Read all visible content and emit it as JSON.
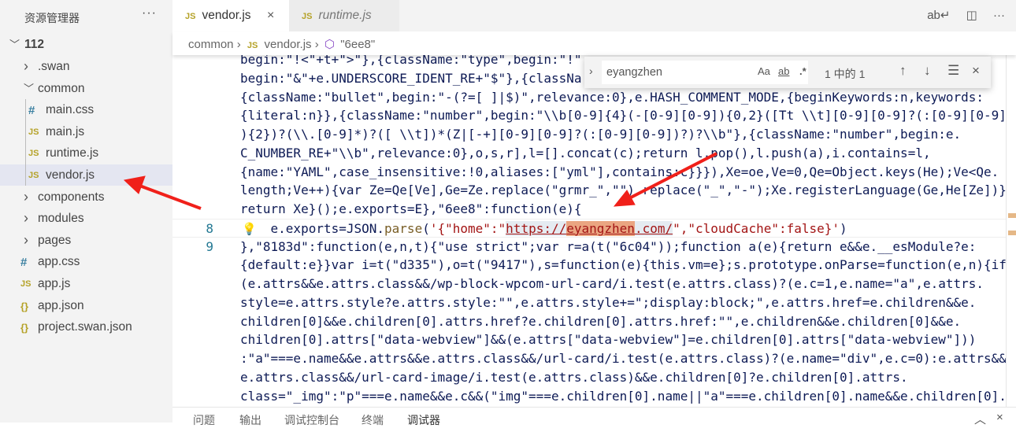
{
  "sidebar": {
    "title": "资源管理器",
    "more": "···",
    "root": "112",
    "items": [
      {
        "label": ".swan",
        "type": "folder",
        "open": false
      },
      {
        "label": "common",
        "type": "folder",
        "open": true
      },
      {
        "label": "main.css",
        "type": "css"
      },
      {
        "label": "main.js",
        "type": "js"
      },
      {
        "label": "runtime.js",
        "type": "js"
      },
      {
        "label": "vendor.js",
        "type": "js",
        "selected": true
      },
      {
        "label": "components",
        "type": "folder",
        "open": false
      },
      {
        "label": "modules",
        "type": "folder",
        "open": false
      },
      {
        "label": "pages",
        "type": "folder",
        "open": false
      },
      {
        "label": "app.css",
        "type": "css"
      },
      {
        "label": "app.js",
        "type": "js"
      },
      {
        "label": "app.json",
        "type": "json"
      },
      {
        "label": "project.swan.json",
        "type": "json"
      }
    ]
  },
  "icons": {
    "js": "JS",
    "css": "#",
    "json": "{}",
    "close": "×",
    "wrap": "word-wrap-icon",
    "split": "split-editor-icon",
    "more": "···"
  },
  "tabs": [
    {
      "label": "vendor.js",
      "active": true
    },
    {
      "label": "runtime.js",
      "active": false
    }
  ],
  "breadcrumb": [
    "common",
    "vendor.js",
    "\"6ee8\""
  ],
  "find": {
    "value": "eyangzhen",
    "match_case": "Aa",
    "whole_word": "ab",
    "regex": ".*",
    "count": "1 中的 1"
  },
  "editor": {
    "rows": [
      {
        "text": "begin:\"!<\"+t+\">\"},{className:\"type\",begin:\"!\""
      },
      {
        "text": "begin:\"&\"+e.UNDERSCORE_IDENT_RE+\"$\"},{classNa"
      },
      {
        "text": "{className:\"bullet\",begin:\"-(?=[ ]|$)\",relevance:0},e.HASH_COMMENT_MODE,{beginKeywords:n,keywords:"
      },
      {
        "text": "{literal:n}},{className:\"number\",begin:\"\\\\b[0-9]{4}(-[0-9][0-9]){0,2}([Tt \\\\t][0-9][0-9]?(:[0-9][0-9]"
      },
      {
        "text": "){2})?(\\\\.[0-9]*)?([ \\\\t])*(Z|[-+][0-9][0-9]?(:[0-9][0-9])?)?\\\\b\"},{className:\"number\",begin:e."
      },
      {
        "text": "C_NUMBER_RE+\"\\\\b\",relevance:0},o,s,r],l=[].concat(c);return l.pop(),l.push(a),i.contains=l,"
      },
      {
        "text": "{name:\"YAML\",case_insensitive:!0,aliases:[\"yml\"],contains:c}}}),Xe=oe,Ve=0,Qe=Object.keys(He);Ve<Qe."
      },
      {
        "text": "length;Ve++){var Ze=Qe[Ve],Ge=Ze.replace(\"grmr_\",\"\").replace(\"_\",\"-\");Xe.registerLanguage(Ge,He[Ze])}"
      },
      {
        "text": "return Xe}();e.exports=E},\"6ee8\":function(e){"
      },
      {
        "line": "8",
        "pre": "    e.exports=JSON.",
        "fn": "parse",
        "open": "(",
        "s1": "'{\"home\":\"",
        "url1": "https://",
        "match": "eyangzhen",
        "url2": ".com/",
        "s2": "\",\"cloudCache\":false}'",
        "close": ")"
      },
      {
        "line": "9",
        "text": "},\"8183d\":function(e,n,t){\"use strict\";var r=a(t(\"6c04\"));function a(e){return e&&e.__esModule?e:"
      },
      {
        "text": "{default:e}}var i=t(\"d335\"),o=t(\"9417\"),s=function(e){this.vm=e};s.prototype.onParse=function(e,n){if"
      },
      {
        "text": "(e.attrs&&e.attrs.class&&/wp-block-wpcom-url-card/i.test(e.attrs.class)?(e.c=1,e.name=\"a\",e.attrs."
      },
      {
        "text": "style=e.attrs.style?e.attrs.style:\"\",e.attrs.style+=\";display:block;\",e.attrs.href=e.children&&e."
      },
      {
        "text": "children[0]&&e.children[0].attrs.href?e.children[0].attrs.href:\"\",e.children&&e.children[0]&&e."
      },
      {
        "text": "children[0].attrs[\"data-webview\"]&&(e.attrs[\"data-webview\"]=e.children[0].attrs[\"data-webview\"]))"
      },
      {
        "text": ":\"a\"===e.name&&e.attrs&&e.attrs.class&&/url-card/i.test(e.attrs.class)?(e.name=\"div\",e.c=0):e.attrs&&"
      },
      {
        "text": "e.attrs.class&&/url-card-image/i.test(e.attrs.class)&&e.children[0]?e.children[0].attrs."
      },
      {
        "text": "class=\"_img\":\"p\"===e.name&&e.c&&(\"img\"===e.children[0].name||\"a\"===e.children[0].name&&e.children[0]."
      }
    ]
  },
  "panel": {
    "tabs": [
      "问题",
      "输出",
      "调试控制台",
      "终端",
      "调试器"
    ],
    "active": "调试器"
  },
  "colors": {
    "accent_arrow": "#f0201a",
    "match": "#eaa581",
    "selected_item": "#e4e6f1"
  }
}
